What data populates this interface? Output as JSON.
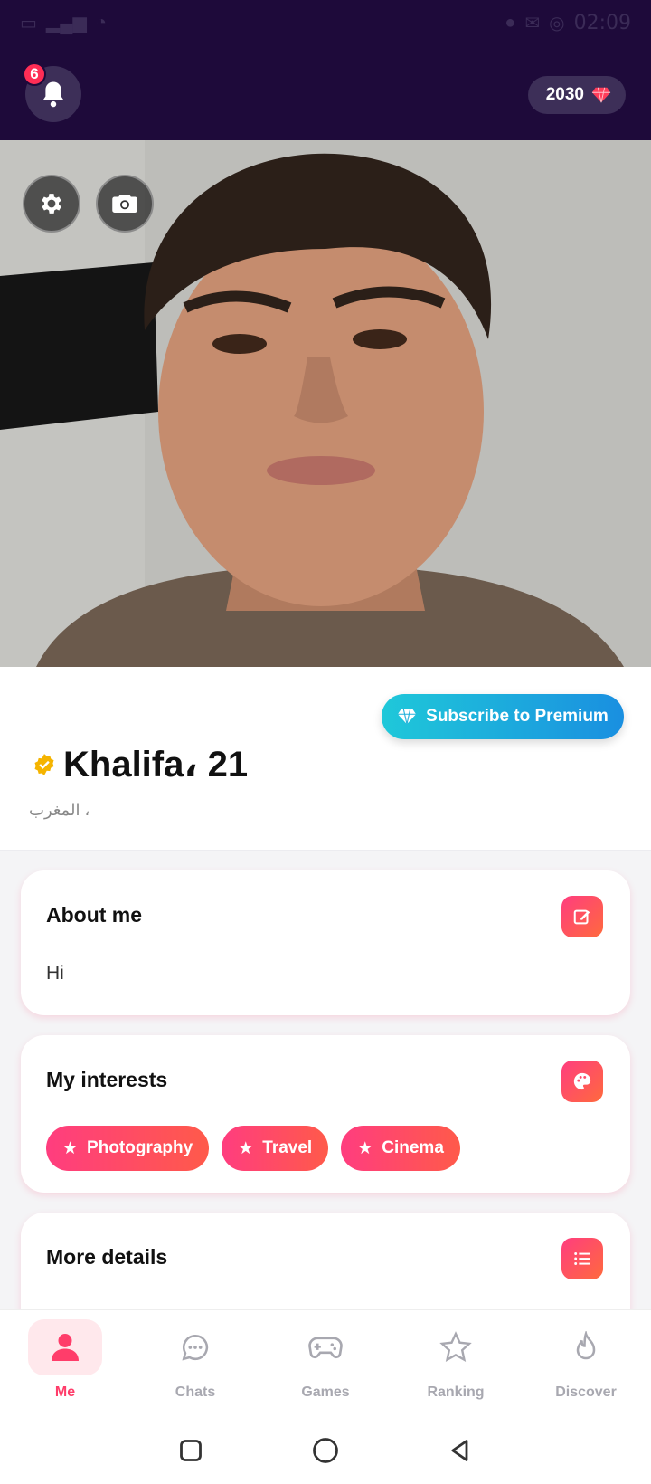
{
  "status_bar": {
    "time": "02:09"
  },
  "header": {
    "notification_count": "6",
    "coins": "2030"
  },
  "profile": {
    "premium_label": "Subscribe to Premium",
    "name_age": "Khalifa، 21",
    "location": "المغرب ،"
  },
  "about": {
    "title": "About me",
    "text": "Hi"
  },
  "interests": {
    "title": "My interests",
    "items": [
      "Photography",
      "Travel",
      "Cinema"
    ]
  },
  "details": {
    "title": "More details"
  },
  "nav": {
    "items": [
      {
        "label": "Me"
      },
      {
        "label": "Chats"
      },
      {
        "label": "Games"
      },
      {
        "label": "Ranking"
      },
      {
        "label": "Discover"
      }
    ]
  },
  "colors": {
    "accent": "#ff3d6a",
    "header_bg": "#1e0a3a",
    "premium": "#1fc8d9",
    "verified": "#f5b400"
  }
}
